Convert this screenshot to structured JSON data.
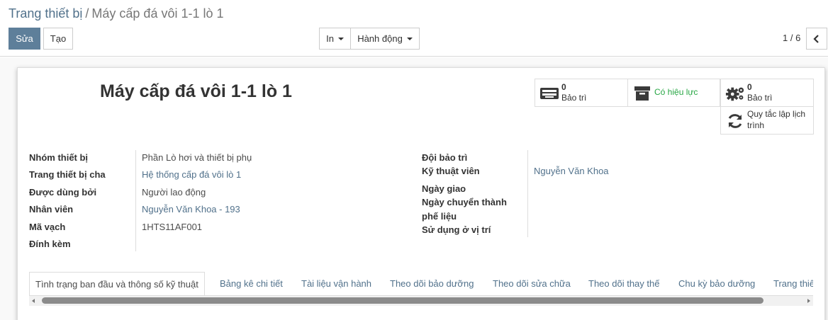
{
  "breadcrumb": {
    "parent": "Trang thiết bị",
    "separator": "/",
    "current": "Máy cấp đá vôi 1-1 lò 1"
  },
  "toolbar": {
    "edit_label": "Sửa",
    "create_label": "Tạo",
    "print_label": "In",
    "action_label": "Hành động"
  },
  "pager": {
    "value": "1 / 6"
  },
  "record": {
    "title": "Máy cấp đá vôi 1-1 lò 1"
  },
  "smart_buttons": {
    "maintenance": {
      "value": "0",
      "label": "Bảo trì",
      "icon": "keyboard-icon"
    },
    "active": {
      "label": "Có hiệu lực",
      "icon": "archive-icon",
      "color": "#28a745"
    },
    "maintenance2": {
      "value": "0",
      "label": "Bảo trì",
      "icon": "gears-icon"
    },
    "schedule": {
      "label_line1": "Quy tắc lập lịch",
      "label_line2": "trình",
      "icon": "refresh-icon"
    }
  },
  "left_fields": [
    {
      "label": "Nhóm thiết bị",
      "value": "Phần Lò hơi và thiết bị phụ"
    },
    {
      "label": "Trang thiết bị cha",
      "value": "Hệ thống cấp đá vôi lò 1"
    },
    {
      "label": "Được dùng bởi",
      "value": "Người lao động"
    },
    {
      "label": "Nhân viên",
      "value": "Nguyễn Văn Khoa - 193"
    },
    {
      "label": "Mã vạch",
      "value": "1HTS11AF001"
    },
    {
      "label": "Đính kèm",
      "value": ""
    }
  ],
  "right_fields": {
    "team_label": "Đội bảo trì",
    "technician_label": "Kỹ thuật viên",
    "technician_value": "Nguyễn Văn Khoa",
    "assign_date_label": "Ngày giao",
    "scrap_date_label_line1": "Ngày chuyển thành",
    "scrap_date_label_line2": "phế liệu",
    "location_label": "Sử dụng ở vị trí"
  },
  "tabs": [
    {
      "label": "Tình trạng ban đầu và thông số kỹ thuật"
    },
    {
      "label": "Bảng kê chi tiết"
    },
    {
      "label": "Tài liệu vận hành"
    },
    {
      "label": "Theo dõi bảo dưỡng"
    },
    {
      "label": "Theo dõi sửa chữa"
    },
    {
      "label": "Theo dõi thay thế"
    },
    {
      "label": "Chu kỳ bảo dưỡng"
    },
    {
      "label": "Trang thiết"
    }
  ],
  "colors": {
    "primary": "#5e7f9a",
    "link": "#51718b",
    "success": "#28a745"
  }
}
